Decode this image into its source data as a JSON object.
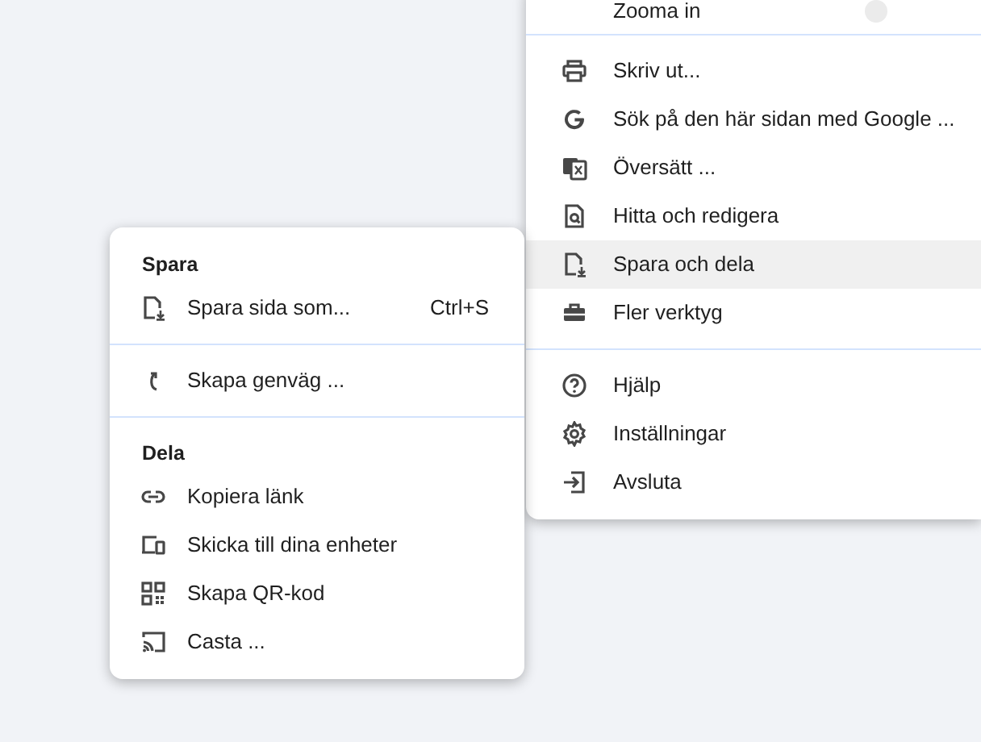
{
  "main_menu": {
    "sections": [
      {
        "items": [
          {
            "kind": "zoom",
            "label": "Zooma in",
            "selected": false
          }
        ]
      },
      {
        "items": [
          {
            "kind": "print",
            "label": "Skriv ut...",
            "selected": false
          },
          {
            "kind": "google",
            "label": "Sök på den här sidan med Google ...",
            "selected": false
          },
          {
            "kind": "translate",
            "label": "Översätt ...",
            "selected": false
          },
          {
            "kind": "find",
            "label": "Hitta och redigera",
            "selected": false
          },
          {
            "kind": "savepage",
            "label": "Spara och dela",
            "selected": true
          },
          {
            "kind": "toolbox",
            "label": "Fler verktyg",
            "selected": false
          }
        ]
      },
      {
        "items": [
          {
            "kind": "help",
            "label": "Hjälp",
            "selected": false
          },
          {
            "kind": "gear",
            "label": "Inställningar",
            "selected": false
          },
          {
            "kind": "exit",
            "label": "Avsluta",
            "selected": false
          }
        ]
      }
    ]
  },
  "submenu": {
    "sections": [
      {
        "heading": "Spara",
        "items": [
          {
            "kind": "savepage",
            "label": "Spara sida som...",
            "shortcut": "Ctrl+S"
          }
        ]
      },
      {
        "items": [
          {
            "kind": "shortcut",
            "label": "Skapa genväg ..."
          }
        ]
      },
      {
        "heading": "Dela",
        "items": [
          {
            "kind": "link",
            "label": "Kopiera länk"
          },
          {
            "kind": "devices",
            "label": "Skicka till dina enheter"
          },
          {
            "kind": "qr",
            "label": "Skapa QR-kod"
          },
          {
            "kind": "cast",
            "label": "Casta ..."
          }
        ]
      }
    ]
  }
}
